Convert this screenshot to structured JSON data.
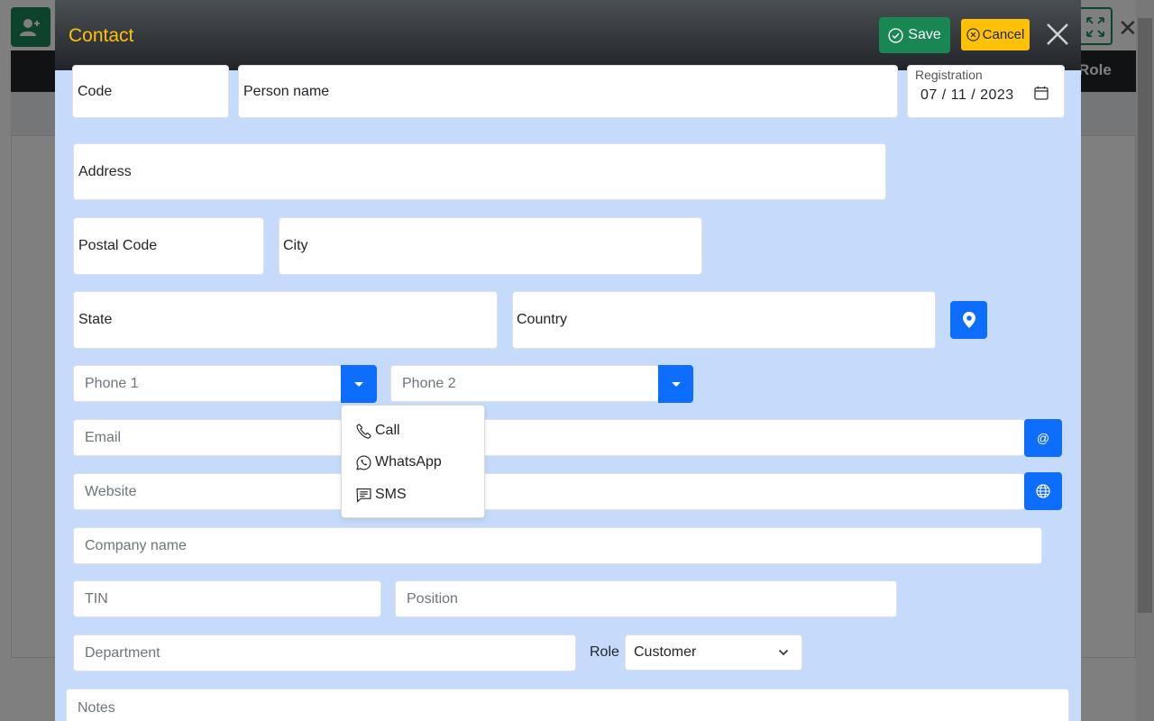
{
  "background": {
    "role_header": "Role"
  },
  "modal": {
    "title": "Contact",
    "save_label": "Save",
    "cancel_label": "Cancel"
  },
  "form": {
    "code": "Code",
    "person_name": "Person name",
    "registration_label": "Registration",
    "registration_date": "07 / 11 / 2023",
    "address": "Address",
    "postal_code": "Postal Code",
    "city": "City",
    "state": "State",
    "country": "Country",
    "phone1_placeholder": "Phone 1",
    "phone2_placeholder": "Phone 2",
    "email_placeholder": "Email",
    "email_button": "@",
    "website_placeholder": "Website",
    "company_placeholder": "Company name",
    "tin_placeholder": "TIN",
    "position_placeholder": "Position",
    "department_placeholder": "Department",
    "role_label": "Role",
    "role_value": "Customer",
    "notes_placeholder": "Notes"
  },
  "phone_menu": {
    "items": [
      "Call",
      "WhatsApp",
      "SMS"
    ]
  },
  "colors": {
    "modal_bg": "#c6dbfb",
    "title": "#ffc107",
    "save": "#198754",
    "cancel": "#ffc107",
    "primary": "#0d6efd"
  },
  "icons": {
    "save": "check-circle-icon",
    "cancel": "x-circle-icon",
    "close": "close-icon",
    "calendar": "calendar-icon",
    "location": "map-pin-icon",
    "phone_dropdown": "caret-down-icon",
    "call": "telephone-icon",
    "whatsapp": "whatsapp-icon",
    "sms": "chat-text-icon",
    "website": "globe-icon",
    "select": "chevron-down-icon"
  }
}
